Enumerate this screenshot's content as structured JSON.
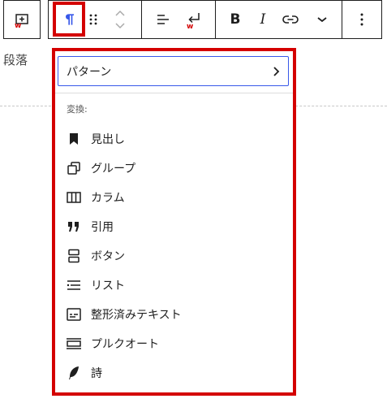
{
  "toolbar": {
    "inserter_icon": "block-inserter-icon",
    "paragraph_icon": "pilcrow-icon",
    "drag_icon": "drag-handle-icon",
    "move_icon": "move-up-down-icon",
    "align_icon": "align-left-icon",
    "link_shortcut_icon": "return-arrow-icon",
    "bold_label": "B",
    "italic_label": "I",
    "link_icon": "link-icon",
    "more_icon": "chevron-down-icon",
    "options_icon": "more-vertical-icon",
    "accent_color": "#3858e9",
    "highlight_color": "#d40000"
  },
  "editor": {
    "paragraph_text": "段落"
  },
  "dropdown": {
    "pattern_label": "パターン",
    "section_label": "変換:",
    "items": [
      {
        "label": "見出し",
        "icon": "bookmark-icon"
      },
      {
        "label": "グループ",
        "icon": "group-icon"
      },
      {
        "label": "カラム",
        "icon": "columns-icon"
      },
      {
        "label": "引用",
        "icon": "quote-icon"
      },
      {
        "label": "ボタン",
        "icon": "buttons-icon"
      },
      {
        "label": "リスト",
        "icon": "list-icon"
      },
      {
        "label": "整形済みテキスト",
        "icon": "preformatted-icon"
      },
      {
        "label": "プルクオート",
        "icon": "pullquote-icon"
      },
      {
        "label": "詩",
        "icon": "verse-icon"
      }
    ]
  }
}
